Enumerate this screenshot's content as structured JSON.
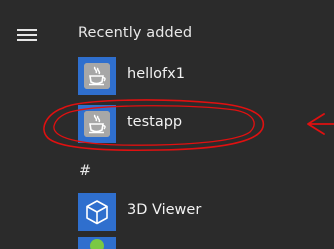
{
  "start_menu": {
    "menu_icon": "hamburger-menu-icon",
    "recently_added_header": "Recently added",
    "apps": [
      {
        "label": "hellofx1",
        "icon": "java-cup-icon"
      },
      {
        "label": "testapp",
        "icon": "java-cup-icon"
      }
    ],
    "letter_header": "#",
    "letter_apps": [
      {
        "label": "3D Viewer",
        "icon": "3d-cube-icon"
      }
    ]
  },
  "colors": {
    "background": "#2b2b2b",
    "tile_blue": "#2f6fce",
    "annotation_red": "#e01010"
  }
}
